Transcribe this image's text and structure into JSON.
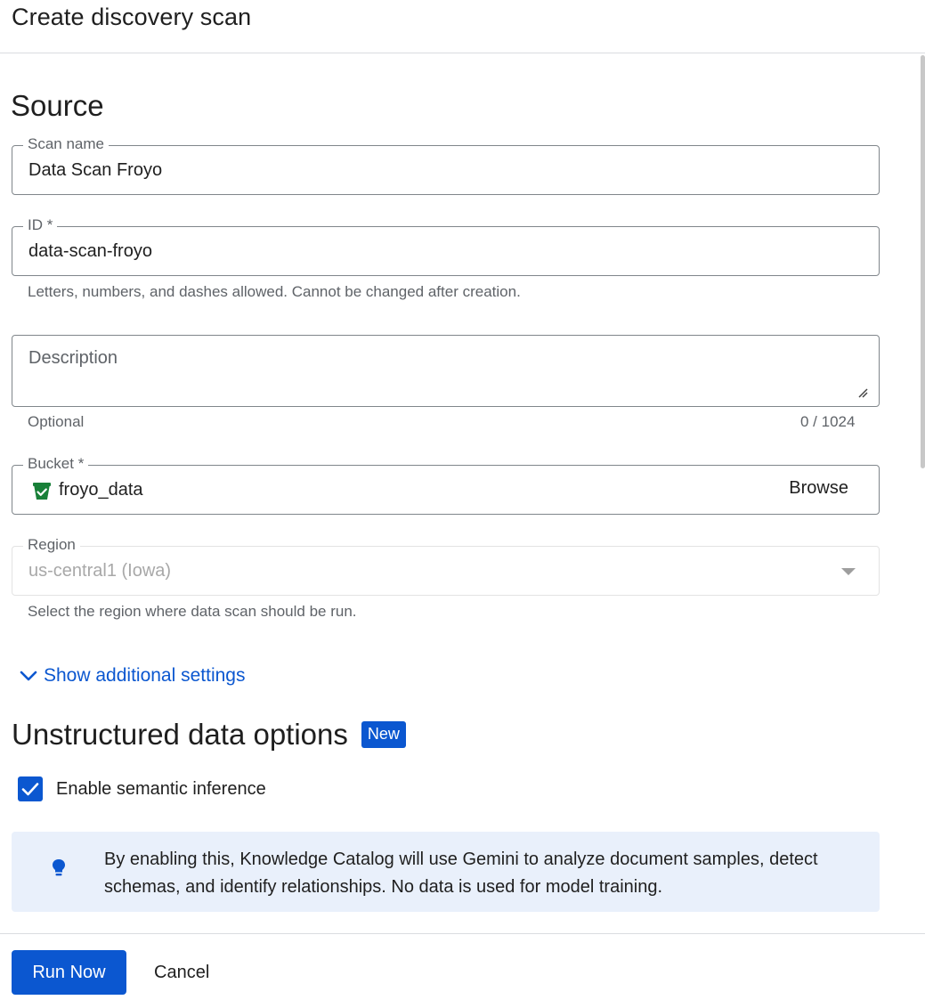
{
  "header": {
    "title": "Create discovery scan"
  },
  "source": {
    "title": "Source",
    "scan_name": {
      "label": "Scan name",
      "value": "Data Scan Froyo"
    },
    "id": {
      "label": "ID *",
      "value": "data-scan-froyo",
      "hint": "Letters, numbers, and dashes allowed. Cannot be changed after creation."
    },
    "description": {
      "placeholder": "Description",
      "hint": "Optional",
      "counter": "0 / 1024"
    },
    "bucket": {
      "label": "Bucket *",
      "value": "froyo_data",
      "browse_label": "Browse"
    },
    "region": {
      "label": "Region",
      "value": "us-central1 (Iowa)",
      "hint": "Select the region where data scan should be run."
    },
    "additional_settings_label": "Show additional settings"
  },
  "unstructured": {
    "title": "Unstructured data options",
    "badge": "New",
    "checkbox_label": "Enable semantic inference",
    "checkbox_checked": true,
    "info_text": "By enabling this, Knowledge Catalog will use Gemini to analyze document samples, detect schemas, and identify relationships. No data is used for model training."
  },
  "footer": {
    "run_label": "Run Now",
    "cancel_label": "Cancel"
  },
  "colors": {
    "primary": "#0b57d0",
    "info_bg": "#e9f0fb",
    "bucket_icon": "#188038"
  }
}
